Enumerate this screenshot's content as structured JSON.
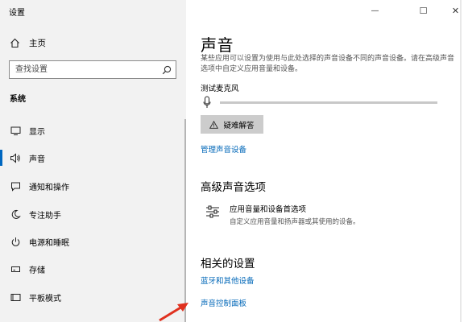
{
  "window": {
    "title": "设置",
    "minimize": "—",
    "maximize": "☐",
    "close": "✕"
  },
  "sidebar": {
    "home_label": "主页",
    "search_placeholder": "查找设置",
    "section": "系统",
    "items": [
      {
        "label": "显示",
        "icon": "display-icon"
      },
      {
        "label": "声音",
        "icon": "speaker-icon",
        "active": true
      },
      {
        "label": "通知和操作",
        "icon": "notification-icon"
      },
      {
        "label": "专注助手",
        "icon": "moon-icon"
      },
      {
        "label": "电源和睡眠",
        "icon": "power-icon"
      },
      {
        "label": "存储",
        "icon": "storage-icon"
      },
      {
        "label": "平板模式",
        "icon": "tablet-icon"
      }
    ]
  },
  "main": {
    "title": "声音",
    "description": "某些应用可以设置为使用与此处选择的声音设备不同的声音设备。请在高级声音选项中自定义应用音量和设备。",
    "mic_label": "测试麦克风",
    "troubleshoot_label": "疑难解答",
    "manage_link": "管理声音设备",
    "advanced": {
      "title": "高级声音选项",
      "item_title": "应用音量和设备首选项",
      "item_sub": "自定义应用音量和扬声器或其使用的设备。"
    },
    "related": {
      "title": "相关的设置",
      "links": [
        "蓝牙和其他设备",
        "声音控制面板"
      ]
    }
  },
  "colors": {
    "accent": "#0067c0",
    "link": "#0067b8",
    "annotation_arrow": "#e0311f"
  }
}
